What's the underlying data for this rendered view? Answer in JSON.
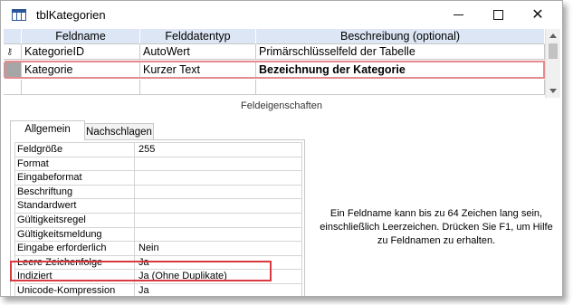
{
  "window": {
    "title": "tblKategorien",
    "controls": {
      "minimize_icon": "minimize-icon",
      "maximize_icon": "maximize-icon",
      "close_icon": "close-icon"
    }
  },
  "grid": {
    "headers": [
      "Feldname",
      "Felddatentyp",
      "Beschreibung (optional)"
    ],
    "rows": [
      {
        "name": "KategorieID",
        "type": "AutoWert",
        "description": "Primärschlüsselfeld der Tabelle",
        "primary_key": true
      },
      {
        "name": "Kategorie",
        "type": "Kurzer Text",
        "description": "Bezeichnung der Kategorie",
        "selected": true
      }
    ]
  },
  "section_label": "Feldeigenschaften",
  "tabs": [
    "Allgemein",
    "Nachschlagen"
  ],
  "properties": [
    {
      "name": "Feldgröße",
      "value": "255"
    },
    {
      "name": "Format",
      "value": ""
    },
    {
      "name": "Eingabeformat",
      "value": ""
    },
    {
      "name": "Beschriftung",
      "value": ""
    },
    {
      "name": "Standardwert",
      "value": ""
    },
    {
      "name": "Gültigkeitsregel",
      "value": ""
    },
    {
      "name": "Gültigkeitsmeldung",
      "value": ""
    },
    {
      "name": "Eingabe erforderlich",
      "value": "Nein"
    },
    {
      "name": "Leere Zeichenfolge",
      "value": "Ja"
    },
    {
      "name": "Indiziert",
      "value": "Ja (Ohne Duplikate)"
    },
    {
      "name": "Unicode-Kompression",
      "value": "Ja"
    }
  ],
  "help_text": "Ein Feldname kann bis zu 64 Zeichen lang sein, einschließlich Leerzeichen. Drücken Sie F1, um Hilfe zu Feldnamen zu erhalten.",
  "colors": {
    "header_bg": "#dce6f4",
    "highlight_row": "#e58a8e",
    "highlight_prop": "#d9393f",
    "selector_selected": "#a6a6a6"
  }
}
